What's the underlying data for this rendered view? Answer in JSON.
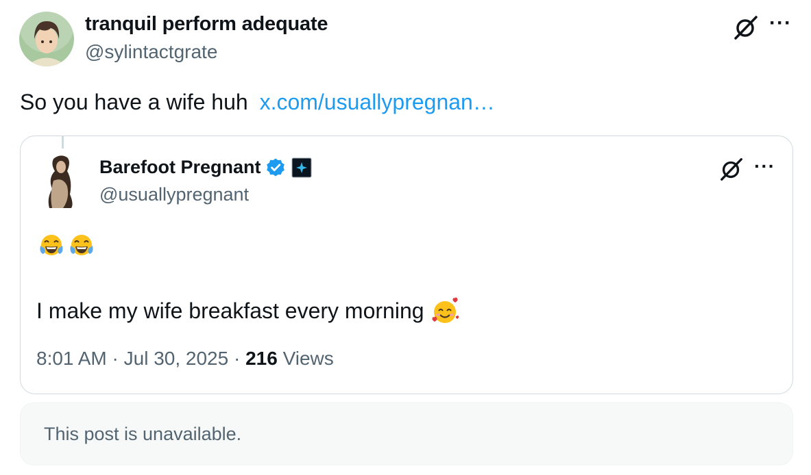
{
  "post": {
    "display_name": "tranquil perform adequate",
    "handle": "@sylintactgrate",
    "text": "So you have a wife huh",
    "link": "x.com/usuallypregnan…"
  },
  "quote": {
    "display_name": "Barefoot Pregnant",
    "handle": "@usuallypregnant",
    "emoji_line": "😂😂",
    "text": "I make my wife breakfast every morning",
    "time": "8:01 AM",
    "date": "Jul 30, 2025",
    "views_count": "216",
    "views_label": "Views"
  },
  "unavailable": {
    "text": "This post is unavailable."
  },
  "icons": {
    "grok": "grok-icon",
    "more": "more-icon",
    "verified": "verified-badge-icon",
    "affiliate": "affiliate-badge-icon"
  },
  "colors": {
    "link": "#1d9bf0",
    "verified": "#1d9bf0",
    "secondary_text": "#536471",
    "border": "#cfd9de"
  }
}
